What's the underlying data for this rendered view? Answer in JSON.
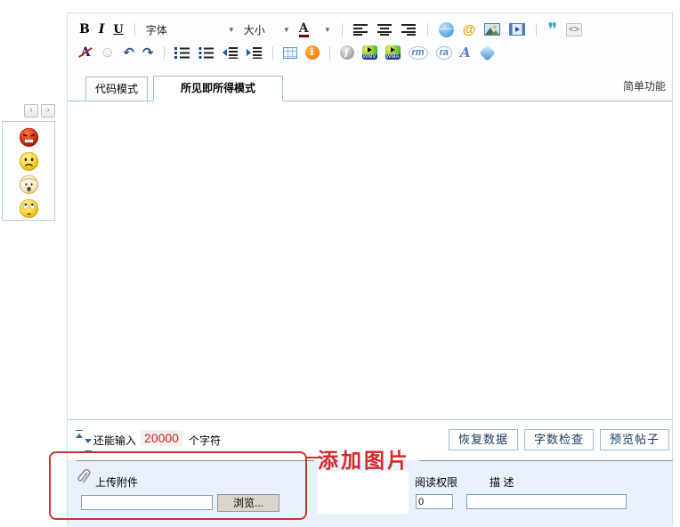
{
  "toolbar": {
    "bold": "B",
    "italic": "I",
    "underline": "U",
    "font_label": "字体",
    "size_label": "大小",
    "color_letter": "A",
    "row1_icons": [
      "bold",
      "italic",
      "underline",
      "font-family-dropdown",
      "font-size-dropdown",
      "font-color-dropdown",
      "align-left",
      "align-center",
      "align-right",
      "link-globe",
      "email",
      "insert-image",
      "insert-video",
      "quote",
      "code"
    ],
    "row2_icons": [
      "remove-format",
      "smiley-disabled",
      "undo",
      "redo",
      "ordered-list",
      "unordered-list",
      "outdent",
      "indent",
      "insert-table",
      "attachment-info",
      "flash",
      "wmv-media",
      "wma-media",
      "realmedia",
      "realaudio",
      "font-style",
      "crystal"
    ]
  },
  "icons": {
    "dropdown_arrow": "▼",
    "prev_glyph": "‹",
    "next_glyph": "›",
    "email_glyph": "@",
    "quote_glyph": "❞",
    "code_glyph": "<>",
    "undo_glyph": "↶",
    "redo_glyph": "↷",
    "smiley_glyph": "☺",
    "noformat_glyph": "A",
    "fontA_glyph": "A",
    "wmv_label": "WMV",
    "wma_label": "WMA",
    "rm_label": "rm",
    "ra_label": "ra"
  },
  "tabs": {
    "code_mode": "代码模式",
    "wysiwyg_mode": "所见即所得模式",
    "simple_mode": "简单功能"
  },
  "status": {
    "remaining_prefix": "还能输入",
    "remaining_count": "20000",
    "remaining_suffix": "个字符"
  },
  "actions": {
    "restore": "恢复数据",
    "wordcount": "字数检查",
    "preview": "预览帖子"
  },
  "attachment": {
    "upload_label": "上传附件",
    "file_value": "",
    "browse_label": "浏览...",
    "read_perm_label": "阅读权限",
    "read_perm_value": "0",
    "desc_label": "描 述",
    "desc_value": ""
  },
  "annotation": {
    "text": "添加图片",
    "color": "#d42a2a"
  },
  "emoticons": [
    "furious-face",
    "sad-face",
    "shocked-face",
    "wide-eyed-face"
  ],
  "colors": {
    "editor_border": "#cfe0ee",
    "tab_border": "#9fc0da",
    "bottom_bg": "#e9f2fa",
    "count_red": "#e21c1c",
    "button_text": "#17365c"
  }
}
